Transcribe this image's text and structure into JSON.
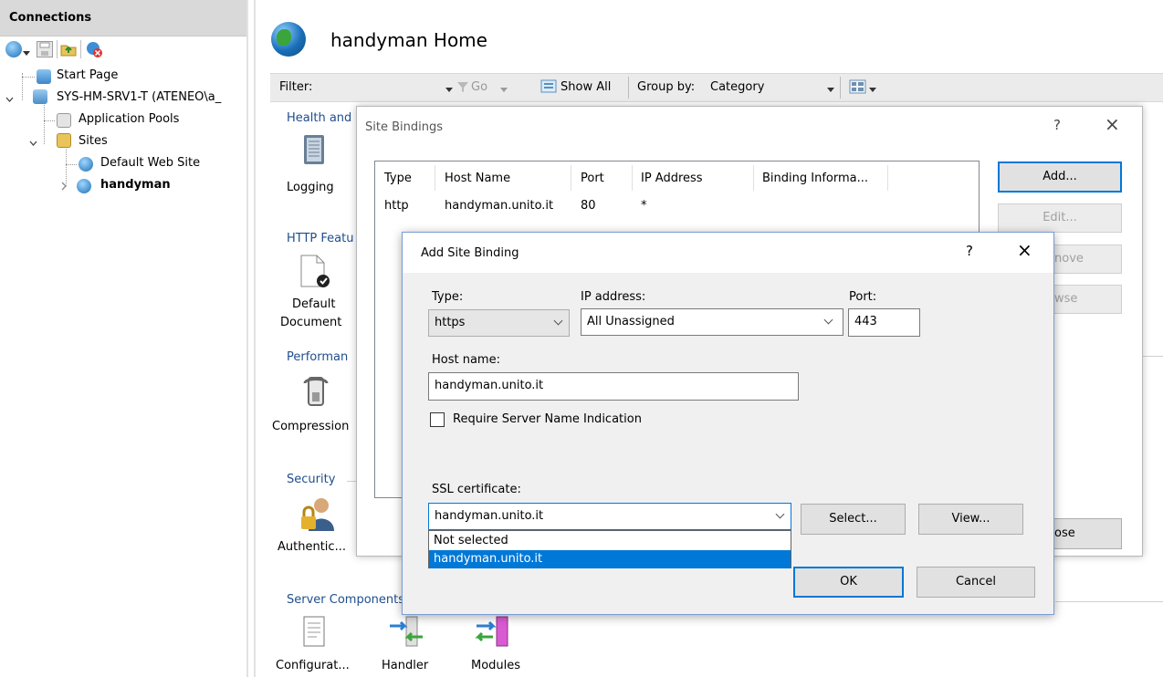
{
  "connections": {
    "title": "Connections",
    "tree": [
      {
        "label": "Start Page"
      },
      {
        "label": "SYS-HM-SRV1-T (ATENEO\\a_"
      },
      {
        "label": "Application Pools"
      },
      {
        "label": "Sites"
      },
      {
        "label": "Default Web Site"
      },
      {
        "label": "handyman"
      }
    ]
  },
  "main": {
    "title": "handyman Home",
    "filterbar": {
      "filter_label": "Filter:",
      "go_label": "Go",
      "show_all_label": "Show All",
      "group_by_label": "Group by:",
      "group_by_value": "Category"
    },
    "groups": {
      "health": "Health and",
      "http": "HTTP Featu",
      "performance": "Performan",
      "security": "Security",
      "server": "Server Components"
    },
    "features": {
      "logging": "Logging",
      "default_doc_1": "Default",
      "default_doc_2": "Document",
      "compression": "Compression",
      "authentication": "Authentic...",
      "configuration": "Configurat...",
      "handler": "Handler",
      "modules": "Modules"
    }
  },
  "site_bindings": {
    "title": "Site Bindings",
    "help": "?",
    "close": "×",
    "columns": [
      "Type",
      "Host Name",
      "Port",
      "IP Address",
      "Binding Informa..."
    ],
    "rows": [
      {
        "type": "http",
        "host": "handyman.unito.it",
        "port": "80",
        "ip": "*",
        "info": ""
      }
    ],
    "buttons": {
      "add": "Add...",
      "edit": "Edit...",
      "remove": "nove",
      "browse": "wse",
      "close": "ose"
    }
  },
  "add_binding": {
    "title": "Add Site Binding",
    "help": "?",
    "close": "×",
    "type_label": "Type:",
    "type_value": "https",
    "ip_label": "IP address:",
    "ip_value": "All Unassigned",
    "port_label": "Port:",
    "port_value": "443",
    "host_label": "Host name:",
    "host_value": "handyman.unito.it",
    "sni_label": "Require Server Name Indication",
    "sni_checked": false,
    "ssl_label": "SSL certificate:",
    "ssl_value": "handyman.unito.it",
    "ssl_options": [
      "Not selected",
      "handyman.unito.it"
    ],
    "ssl_selected_index": 1,
    "select_button": "Select...",
    "view_button": "View...",
    "ok_button": "OK",
    "cancel_button": "Cancel"
  },
  "colors": {
    "accent": "#0078d7",
    "group_header": "#1e4e8c",
    "title_bg": "#d9d9d9"
  }
}
